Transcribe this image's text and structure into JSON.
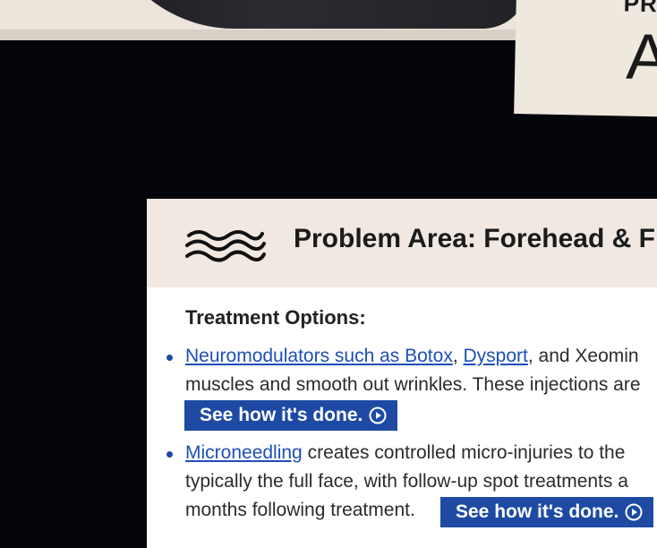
{
  "hero": {
    "eyebrow": "PR",
    "title": "A"
  },
  "card": {
    "title": "Problem Area: Forehead & F",
    "section_heading": "Treatment Options:",
    "items": [
      {
        "link1": "Neuromodulators such as Botox",
        "sep1": ", ",
        "link2": "Dysport",
        "text1": ", and Xeomin",
        "text2": "muscles and smooth out wrinkles. These injections are",
        "button": "See how it's done."
      },
      {
        "link1": "Microneedling",
        "text1": " creates controlled micro-injuries to the",
        "text2": "typically the full face, with follow-up spot treatments a",
        "text3": "months following treatment.",
        "button": "See how it's done."
      }
    ]
  },
  "colors": {
    "accent": "#1e4aa3",
    "link": "#1d4fb8",
    "header_bg": "#f1e9e1",
    "background": "#04050b"
  },
  "icons": {
    "header": "wave-lines-icon",
    "button": "play-circle-icon"
  }
}
